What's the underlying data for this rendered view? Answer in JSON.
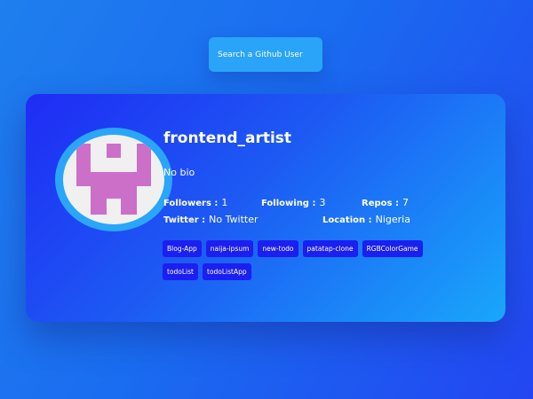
{
  "search": {
    "placeholder": "Search a Github User"
  },
  "profile": {
    "username": "frontend_artist",
    "bio": "No bio",
    "followers_label": "Followers :",
    "followers": "1",
    "following_label": "Following :",
    "following": "3",
    "repos_label": "Repos :",
    "repos": "7",
    "twitter_label": "Twitter :",
    "twitter": "No Twitter",
    "location_label": "Location :",
    "location": "Nigeria",
    "avatar_icon": "identicon-avatar",
    "avatar_color": "#cc6fc9"
  },
  "repos": [
    "Blog-App",
    "naija-ipsum",
    "new-todo",
    "patatap-clone",
    "RGBColorGame",
    "todoList",
    "todoListApp"
  ],
  "colors": {
    "background": "#1a6cf0",
    "card_start": "#1f2cf5",
    "card_end": "#19a7fb",
    "search_bg": "#2aa4f8",
    "repo_tag": "#1b1ff0"
  }
}
